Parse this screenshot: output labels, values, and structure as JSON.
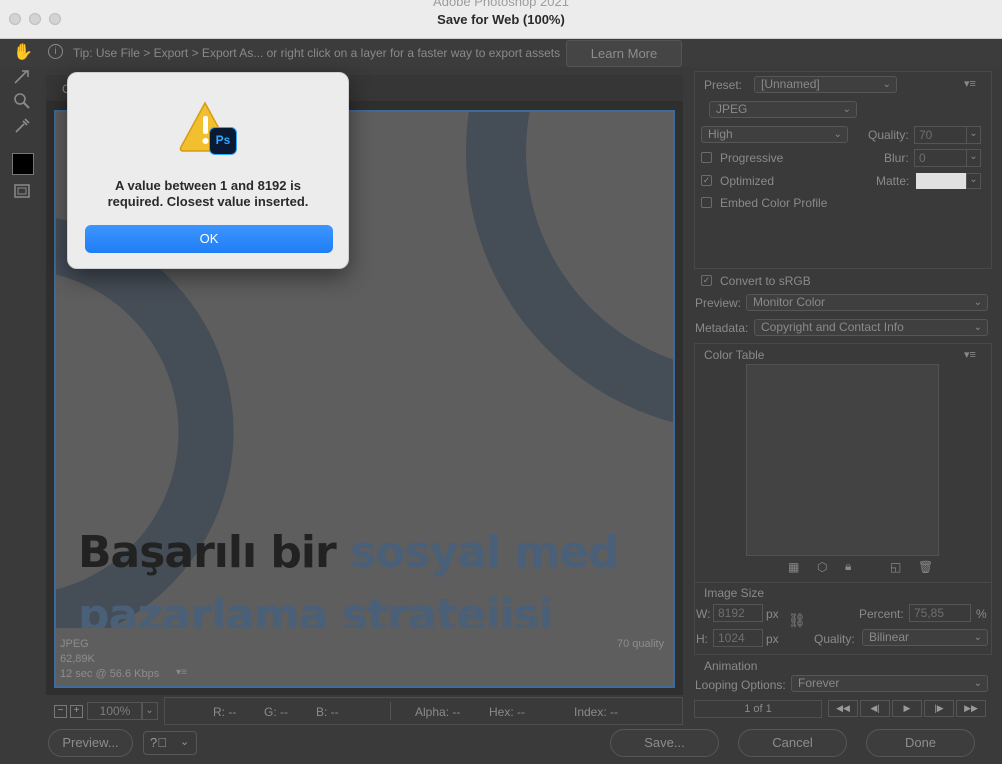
{
  "window": {
    "background_title": "Adobe Photoshop 2021",
    "title": "Save for Web (100%)"
  },
  "tipbar": {
    "text": "Tip: Use File > Export > Export As...  or right click on a layer for a faster way to export assets",
    "learn_more": "Learn More"
  },
  "canvas": {
    "tab_label": "O",
    "headline_1a": "Başarılı bir ",
    "headline_1b": "sosyal med",
    "headline_2": "pazarlama stratejisi",
    "info_format": "JPEG",
    "info_size": "62,89K",
    "info_time": "12 sec @ 56.6 Kbps",
    "info_quality": "70 quality"
  },
  "dialog": {
    "icon_badge": "Ps",
    "message_line1": "A value between 1 and 8192 is",
    "message_line2": "required. Closest value inserted.",
    "ok": "OK"
  },
  "settings": {
    "preset_label": "Preset:",
    "preset_value": "[Unnamed]",
    "format_value": "JPEG",
    "quality_level": "High",
    "quality_label": "Quality:",
    "quality_value": "70",
    "progressive_label": "Progressive",
    "blur_label": "Blur:",
    "blur_value": "0",
    "optimized_label": "Optimized",
    "matte_label": "Matte:",
    "embed_label": "Embed Color Profile",
    "convert_label": "Convert to sRGB",
    "preview_label": "Preview:",
    "preview_value": "Monitor Color",
    "metadata_label": "Metadata:",
    "metadata_value": "Copyright and Contact Info",
    "color_table_label": "Color Table",
    "image_size_label": "Image Size",
    "w_label": "W:",
    "w_value": "8192",
    "h_label": "H:",
    "h_value": "1024",
    "px": "px",
    "percent_label": "Percent:",
    "percent_value": "75,85",
    "percent_unit": "%",
    "quality2_label": "Quality:",
    "quality2_value": "Bilinear",
    "animation_label": "Animation",
    "looping_label": "Looping Options:",
    "looping_value": "Forever",
    "frame_counter": "1 of 1"
  },
  "status": {
    "zoom": "100%",
    "r": "R: --",
    "g": "G: --",
    "b": "B: --",
    "alpha": "Alpha: --",
    "hex": "Hex: --",
    "index": "Index: --"
  },
  "buttons": {
    "preview": "Preview...",
    "save": "Save...",
    "cancel": "Cancel",
    "done": "Done"
  },
  "colors": {
    "accent_blue": "#1f7ef5",
    "selection_blue": "#3e6b99",
    "headline_dark": "#2b2b2b",
    "headline_blue": "#5b7ea6"
  }
}
